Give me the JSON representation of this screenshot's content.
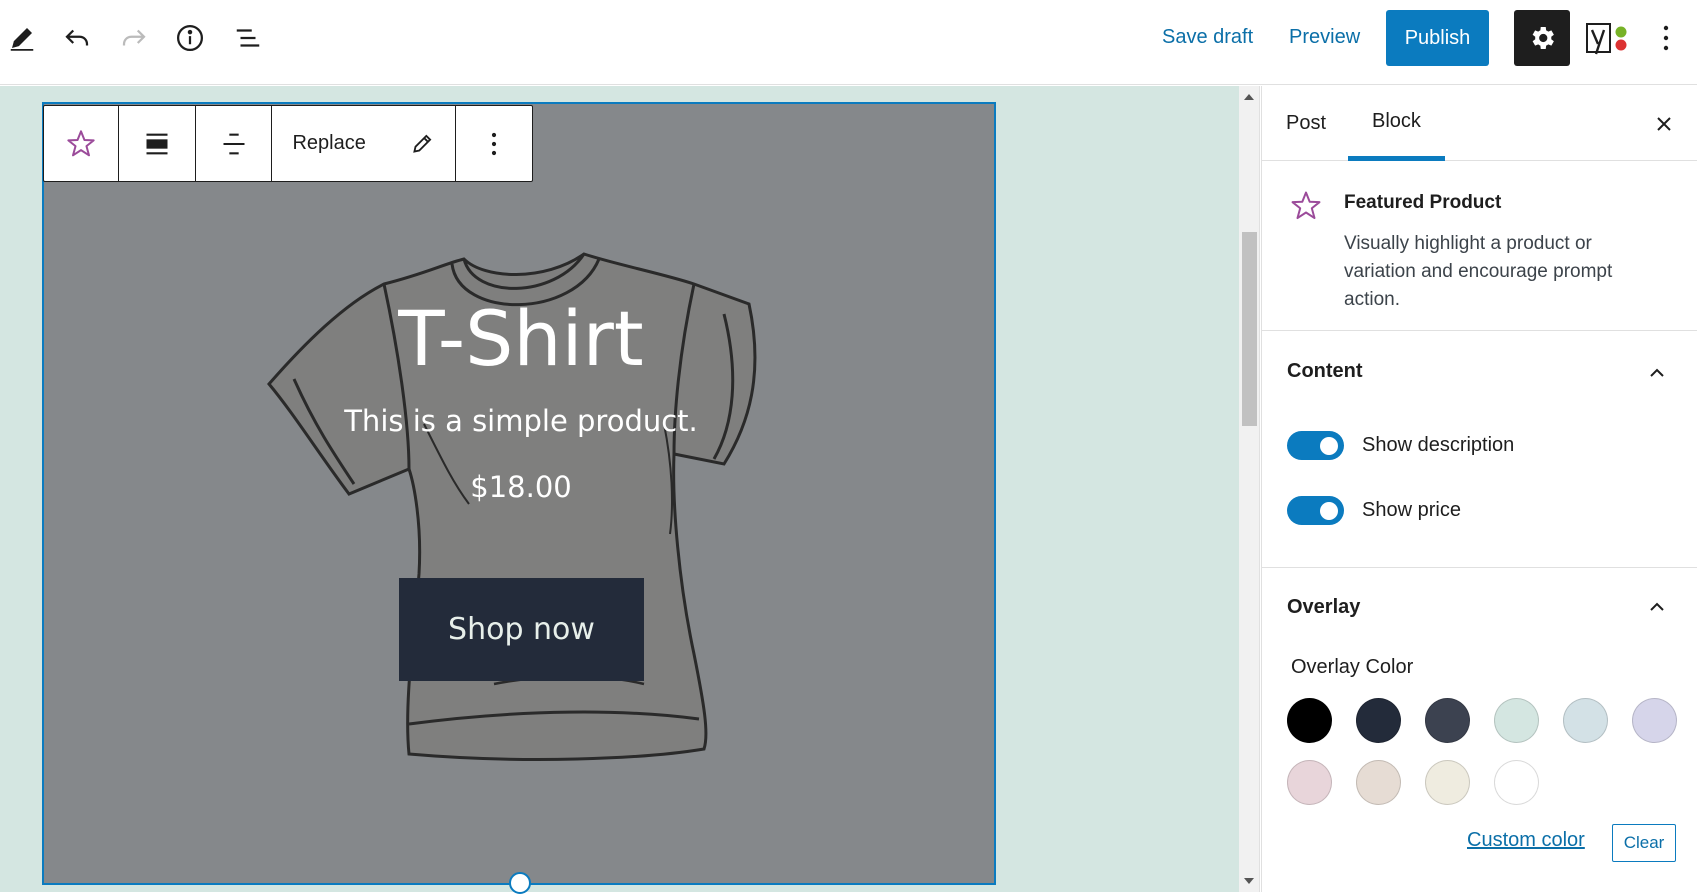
{
  "toolbar": {
    "save_draft": "Save draft",
    "preview": "Preview",
    "publish": "Publish",
    "icons": [
      "pencil-icon",
      "undo-icon",
      "redo-icon",
      "info-icon",
      "list-view-icon",
      "gear-icon",
      "yoast-icon",
      "more-vertical-icon"
    ]
  },
  "block_toolbar": {
    "replace": "Replace",
    "icons": [
      "star-icon",
      "align-wide-icon",
      "align-center-icon",
      "pencil-icon",
      "more-vertical-icon"
    ]
  },
  "block": {
    "title": "T-Shirt",
    "description": "This is a simple product.",
    "price": "$18.00",
    "button": "Shop now"
  },
  "sidebar": {
    "tabs": [
      {
        "label": "Post"
      },
      {
        "label": "Block",
        "active": true
      }
    ],
    "card": {
      "title": "Featured Product",
      "description": "Visually highlight a product or variation and encourage prompt action."
    },
    "content_panel": {
      "title": "Content",
      "show_description": "Show description",
      "show_description_on": true,
      "show_price": "Show price",
      "show_price_on": true
    },
    "overlay_panel": {
      "title": "Overlay",
      "overlay_color_label": "Overlay Color",
      "swatches": [
        "#000000",
        "#232b3a",
        "#3c4250",
        "#d4e6e1",
        "#d3e1e6",
        "#d6d5ea",
        "#e8d5da",
        "#e6dcd4",
        "#efece0",
        "#ffffff"
      ],
      "custom_color": "Custom color",
      "clear": "Clear"
    }
  },
  "colors": {
    "accent": "#0b7bbf",
    "canvas_bg": "#d4e6e1",
    "block_bg": "#85888b",
    "button_bg": "#232b3a"
  }
}
